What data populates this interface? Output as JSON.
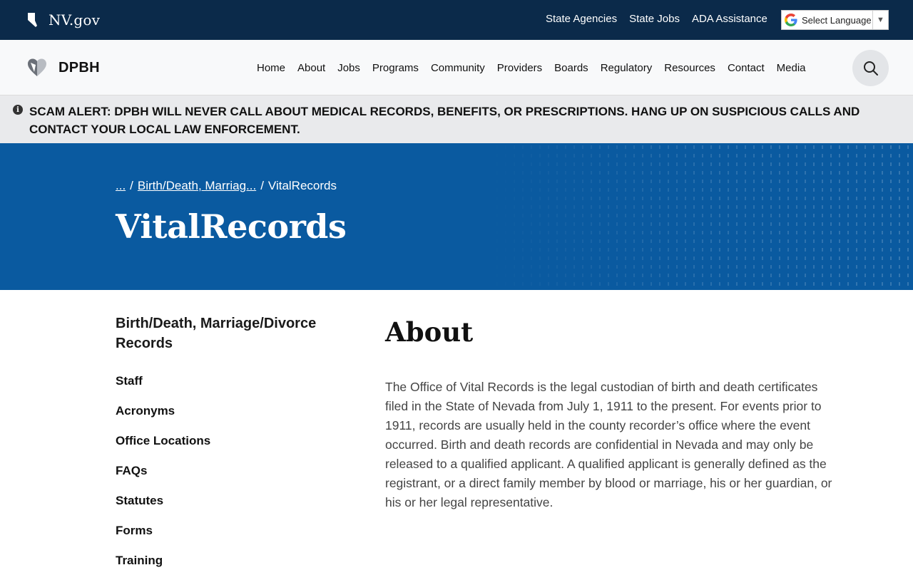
{
  "topbar": {
    "brand": "NV.gov",
    "links": [
      "State Agencies",
      "State Jobs",
      "ADA Assistance"
    ],
    "language_label": "Select Language"
  },
  "nav": {
    "logo_text": "DPBH",
    "items": [
      "Home",
      "About",
      "Jobs",
      "Programs",
      "Community",
      "Providers",
      "Boards",
      "Regulatory",
      "Resources",
      "Contact",
      "Media"
    ]
  },
  "alert": {
    "text": "SCAM ALERT: DPBH WILL NEVER CALL ABOUT MEDICAL RECORDS, BENEFITS, OR PRESCRIPTIONS. HANG UP ON SUSPICIOUS CALLS AND CONTACT YOUR LOCAL LAW ENFORCEMENT."
  },
  "hero": {
    "breadcrumb": [
      "...",
      "Birth/Death, Marriag...",
      "VitalRecords"
    ],
    "title": "VitalRecords"
  },
  "sidebar": {
    "title": "Birth/Death, Marriage/Divorce Records",
    "items": [
      "Staff",
      "Acronyms",
      "Office Locations",
      "FAQs",
      "Statutes",
      "Forms",
      "Training"
    ]
  },
  "content": {
    "heading": "About",
    "body": "The Office of Vital Records is the legal custodian of birth and death certificates filed in the State of Nevada from July 1, 1911 to the present. For events prior to 1911, records are usually held in the county recorder’s office where the event occurred. Birth and death records are confidential in Nevada and may only be released to a qualified applicant. A qualified applicant is generally defined as the registrant, or a direct family member by blood or marriage, his or her guardian, or his or her legal representative."
  },
  "colors": {
    "topbar_bg": "#0b2a4a",
    "hero_bg": "#0a5aa0",
    "alert_bg": "#e9eaec"
  }
}
